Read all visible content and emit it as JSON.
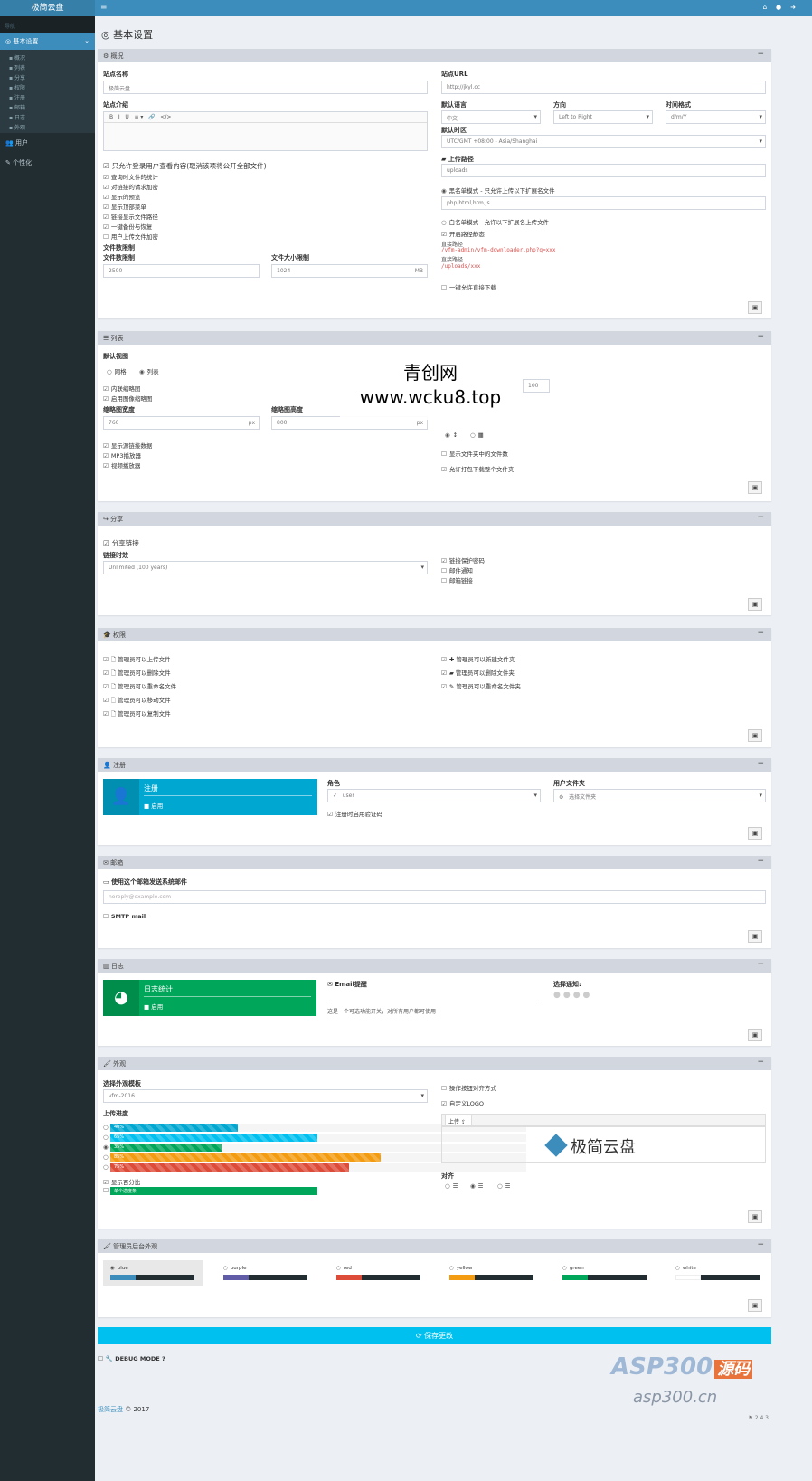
{
  "app": {
    "brand": "极简云盘",
    "version": "2.4.3"
  },
  "sidebar": {
    "heading": "导航",
    "active": "基本设置",
    "sub": [
      "概况",
      "列表",
      "分享",
      "权限",
      "注册",
      "邮箱",
      "日志",
      "外观"
    ],
    "items": [
      "用户",
      "个性化"
    ]
  },
  "page": {
    "title": "基本设置"
  },
  "general": {
    "title": "概况",
    "site_name_label": "站点名称",
    "site_name_value": "极简云盘",
    "site_url_label": "站点URL",
    "site_url_value": "http://jkyl.cc",
    "desc_label": "站点介绍",
    "lang_label": "默认语言",
    "lang_value": "中文",
    "dir_label": "方向",
    "dir_value": "Left to Right",
    "time_label": "时间格式",
    "time_value": "d/m/Y",
    "tz_label": "默认时区",
    "tz_value": "UTC/GMT +08:00 - Asia/Shanghai",
    "checks": [
      "只允许登录用户查看内容(取消该项将公开全部文件)",
      "查询时文件的统计",
      "对链接的请求加密",
      "显示的预览",
      "显示顶部菜单",
      "链接显示文件路径",
      "一键备份与恢复",
      "用户上传文件加密"
    ],
    "upload_label": "上传路径",
    "upload_value": "uploads",
    "upload_hint1": "黑名单模式 - 只允许上传以下扩展名文件",
    "exts_value": "php,html,htm,js",
    "upload_hint2": "白名单模式 - 允许以下扩展名上传文件",
    "secure_label": "开启路径静态",
    "red1": "/vfm-admin/vfm-downloader.php?q=xxx",
    "hint_direct": "直接路径",
    "red2": "/uploads/xxx",
    "direct_dl": "一键允许直接下载",
    "limit_label": "文件数限制",
    "count_label": "文件数限制",
    "count_value": "2500",
    "size_label": "文件大小限制",
    "size_value": "1024",
    "size_unit": "MB"
  },
  "lists": {
    "title": "列表",
    "view_label": "默认视图",
    "view_grid": "网格",
    "view_list": "列表",
    "checks": [
      "内联缩略图",
      "启用图像缩略图"
    ],
    "thumbw_label": "缩略图宽度",
    "thumbw_value": "760",
    "thumbh_label": "缩略图高度",
    "thumbh_value": "800",
    "unit": "px",
    "checks2": [
      "显示源链接数据",
      "MP3播放器",
      "视频播放器"
    ],
    "per_page": "100",
    "show_folders": "显示文件夹中的文件数",
    "zip_all": "允许打包下载整个文件夹"
  },
  "share": {
    "title": "分享",
    "enable": "分享链接",
    "lifetime_label": "链接时效",
    "lifetime_value": "Unlimited (100 years)",
    "opts": [
      "链接保护密码",
      "邮件通知",
      "邮箱链接"
    ]
  },
  "perms": {
    "title": "权限",
    "left": [
      "管理员可以上传文件",
      "管理员可以删除文件",
      "管理员可以重命名文件",
      "管理员可以移动文件",
      "管理员可以复制文件"
    ],
    "right": [
      "管理员可以新建文件夹",
      "管理员可以删除文件夹",
      "管理员可以重命名文件夹"
    ]
  },
  "register": {
    "title": "注册",
    "box_title": "注册",
    "box_sub": "启用",
    "role_label": "角色",
    "role_value": "user",
    "folder_label": "用户文件夹",
    "folder_value": "选择文件夹",
    "captcha": "注册时启用验证码"
  },
  "email": {
    "title": "邮箱",
    "label": "使用这个邮箱发送系统邮件",
    "placeholder": "noreply@example.com",
    "smtp": "SMTP mail"
  },
  "logs": {
    "title": "日志",
    "box_title": "日志统计",
    "box_sub": "启用",
    "email_label": "Email提醒",
    "hint": "这是一个可选功能开关，对所有用户都可使用",
    "choose": "选择通知:"
  },
  "appearance": {
    "title": "外观",
    "theme_label": "选择外观模板",
    "theme_value": "vfm-2016",
    "progress_label": "上传进度",
    "bars": [
      {
        "label": "40%",
        "value": 40,
        "color": "#00a7d0"
      },
      {
        "label": "65%",
        "value": 65,
        "color": "#00c0ef"
      },
      {
        "label": "35%",
        "value": 35,
        "color": "#00a65a"
      },
      {
        "label": "85%",
        "value": 85,
        "color": "#f39c12"
      },
      {
        "label": "75%",
        "value": 75,
        "color": "#dd4b39"
      }
    ],
    "fullwidth": "显示百分比",
    "single": "单个进度条",
    "bar_single": {
      "label": "单个进度条",
      "value": 65,
      "color": "#00a65a"
    },
    "inline": "操作按钮对齐方式",
    "logo_label": "自定义LOGO",
    "logo_tab": "上传",
    "logo_text": "极简云盘",
    "align": "对齐"
  },
  "skins": {
    "title": "管理员后台外观",
    "list": [
      {
        "name": "blue",
        "color": "#3c8dbc"
      },
      {
        "name": "purple",
        "color": "#605ca8"
      },
      {
        "name": "red",
        "color": "#dd4b39"
      },
      {
        "name": "yellow",
        "color": "#f39c12"
      },
      {
        "name": "green",
        "color": "#00a65a"
      },
      {
        "name": "white",
        "color": "#ffffff"
      }
    ]
  },
  "save_all": "保存更改",
  "debug": "DEBUG MODE",
  "footer": {
    "brand": "极简云盘",
    "year": "© 2017",
    "version": "2.4.3"
  },
  "watermark": {
    "line1": "青创网",
    "line2": "www.wcku8.top",
    "asp1": "ASP300",
    "asp2": "源码",
    "asp3": "asp300.cn"
  }
}
